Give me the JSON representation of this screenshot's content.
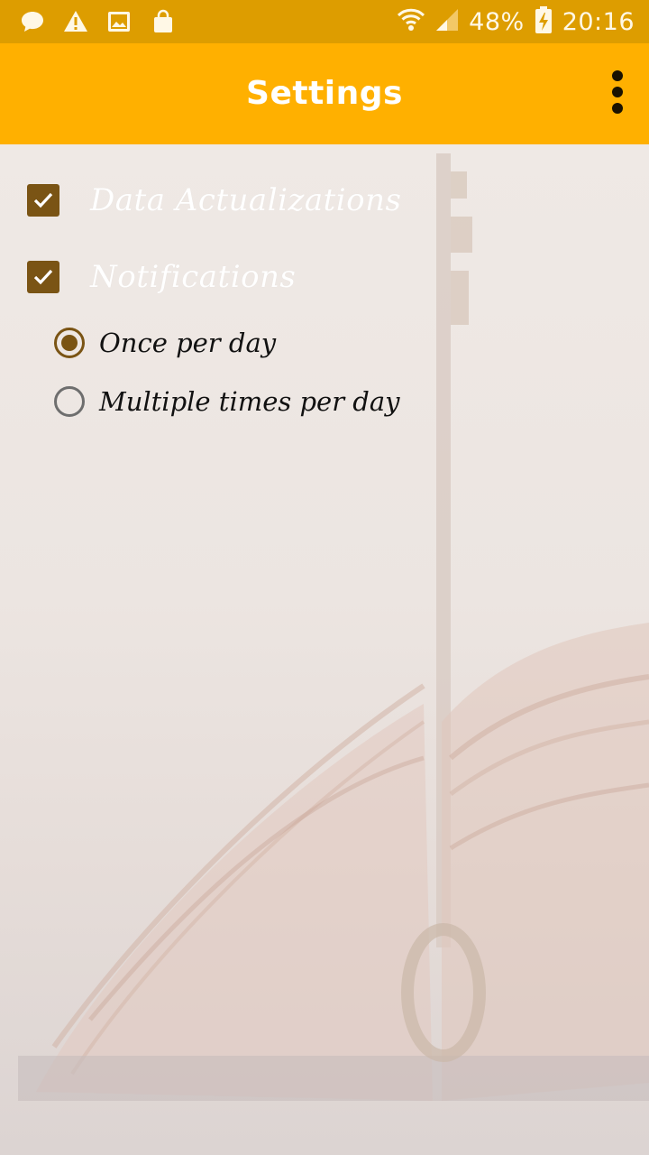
{
  "status_bar": {
    "battery": "48%",
    "time": "20:16",
    "icons": [
      "chat-bubble-icon",
      "warning-icon",
      "image-icon",
      "shopping-bag-icon",
      "wifi-icon",
      "signal-icon",
      "battery-charging-icon"
    ]
  },
  "app_bar": {
    "title": "Settings",
    "menu_icon": "more-vert-icon"
  },
  "settings": {
    "data_actualizations": {
      "label": "Data Actualizations",
      "checked": true
    },
    "notifications": {
      "label": "Notifications",
      "checked": true
    },
    "frequency_options": [
      {
        "label": "Once per day",
        "selected": true
      },
      {
        "label": "Multiple times per day",
        "selected": false
      }
    ]
  },
  "colors": {
    "status_bar": "#dd9d00",
    "app_bar": "#ffb000",
    "accent": "#7a5414"
  }
}
